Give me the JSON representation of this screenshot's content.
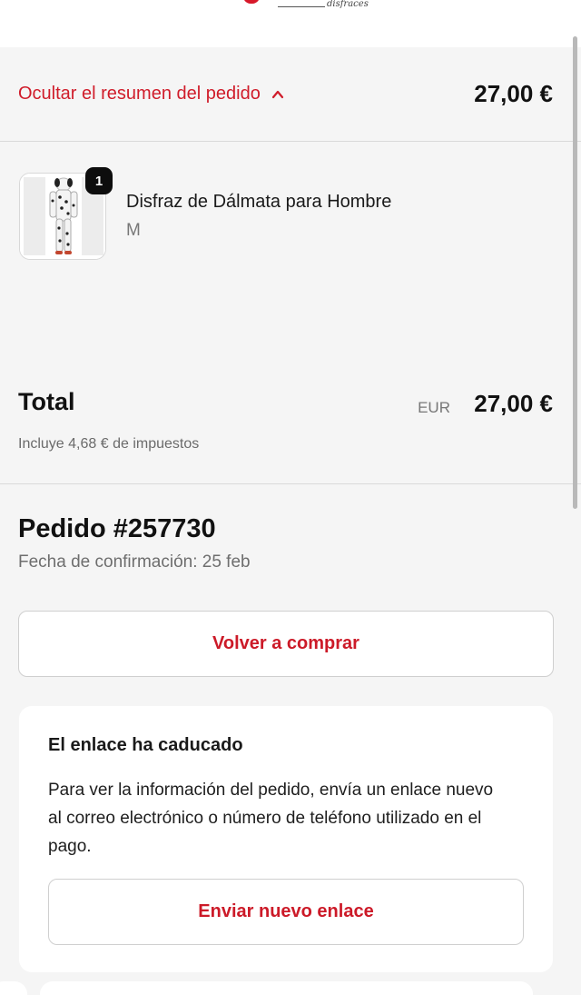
{
  "header": {
    "logo_text": "disfraces"
  },
  "summary": {
    "toggle_label": "Ocultar el resumen del pedido",
    "amount": "27,00 €"
  },
  "product": {
    "quantity": "1",
    "name": "Disfraz de Dálmata para Hombre",
    "variant": "M"
  },
  "totals": {
    "label": "Total",
    "currency": "EUR",
    "amount": "27,00 €",
    "tax_note": "Incluye 4,68 € de impuestos"
  },
  "order": {
    "title": "Pedido #257730",
    "date": "Fecha de confirmación: 25 feb",
    "buy_again_label": "Volver a comprar"
  },
  "expired_card": {
    "title": "El enlace ha caducado",
    "body": "Para ver la información del pedido, envía un enlace nuevo al correo electrónico o número de teléfono utilizado en el pago.",
    "button_label": "Enviar nuevo enlace"
  },
  "colors": {
    "accent": "#d01c2a",
    "background": "#f5f5f5",
    "text": "#111111"
  },
  "icons": {
    "toggle": "chevron-up-icon"
  }
}
